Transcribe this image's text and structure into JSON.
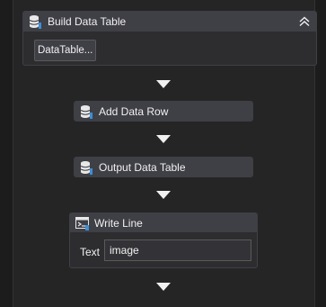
{
  "workflow": {
    "build_data_table": {
      "title": "Build Data Table",
      "datatable_button": "DataTable...",
      "icon": "database-icon",
      "collapse_icon": "double-chevron-up-icon"
    },
    "add_data_row": {
      "title": "Add Data Row",
      "icon": "database-icon"
    },
    "output_data_table": {
      "title": "Output Data Table",
      "icon": "database-icon"
    },
    "write_line": {
      "title": "Write Line",
      "icon": "console-icon",
      "text_label": "Text",
      "text_value": "image"
    },
    "connector_icon": "down-arrow-icon"
  },
  "colors": {
    "background": "#252526",
    "activity_header": "#3f3f46",
    "text": "#f1f1f1"
  }
}
